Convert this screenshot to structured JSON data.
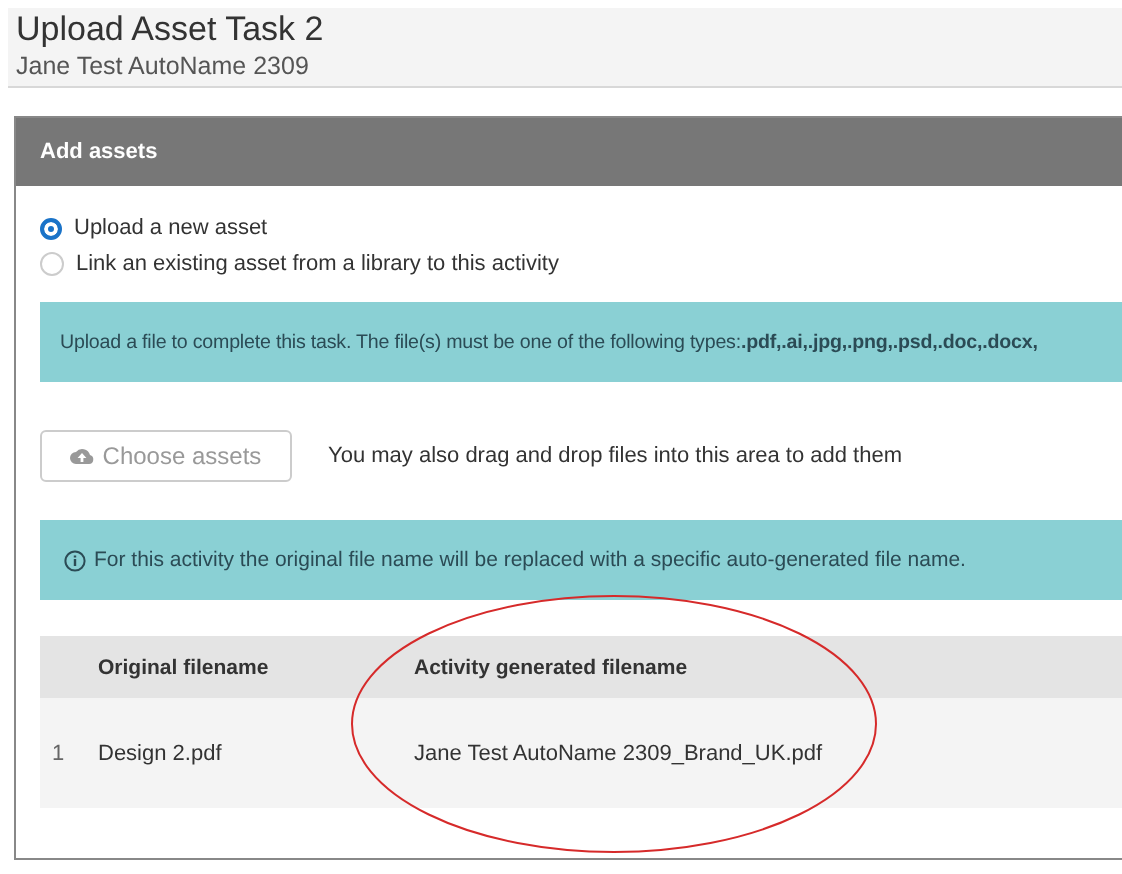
{
  "header": {
    "title": "Upload Asset Task 2",
    "subtitle": "Jane Test AutoName 2309"
  },
  "panel": {
    "title": "Add assets",
    "options": [
      {
        "label": "Upload a new asset",
        "selected": true
      },
      {
        "label": "Link an existing asset from a library to this activity",
        "selected": false
      }
    ],
    "types_notice": "Upload a file to complete this task. The file(s) must be one of the following types:**.pdf,.ai,.jpg,.png,.psd,.doc,.docx,**",
    "choose_button": "Choose assets",
    "drop_hint": "You may also drag and drop files into this area to add them",
    "info_notice": "For this activity the original file name will be replaced with a specific auto-generated file name.",
    "table": {
      "columns": [
        "Original filename",
        "Activity generated filename"
      ],
      "rows": [
        {
          "index": "1",
          "original": "Design 2.pdf",
          "generated": "Jane Test AutoName 2309_Brand_UK.pdf"
        }
      ]
    }
  }
}
